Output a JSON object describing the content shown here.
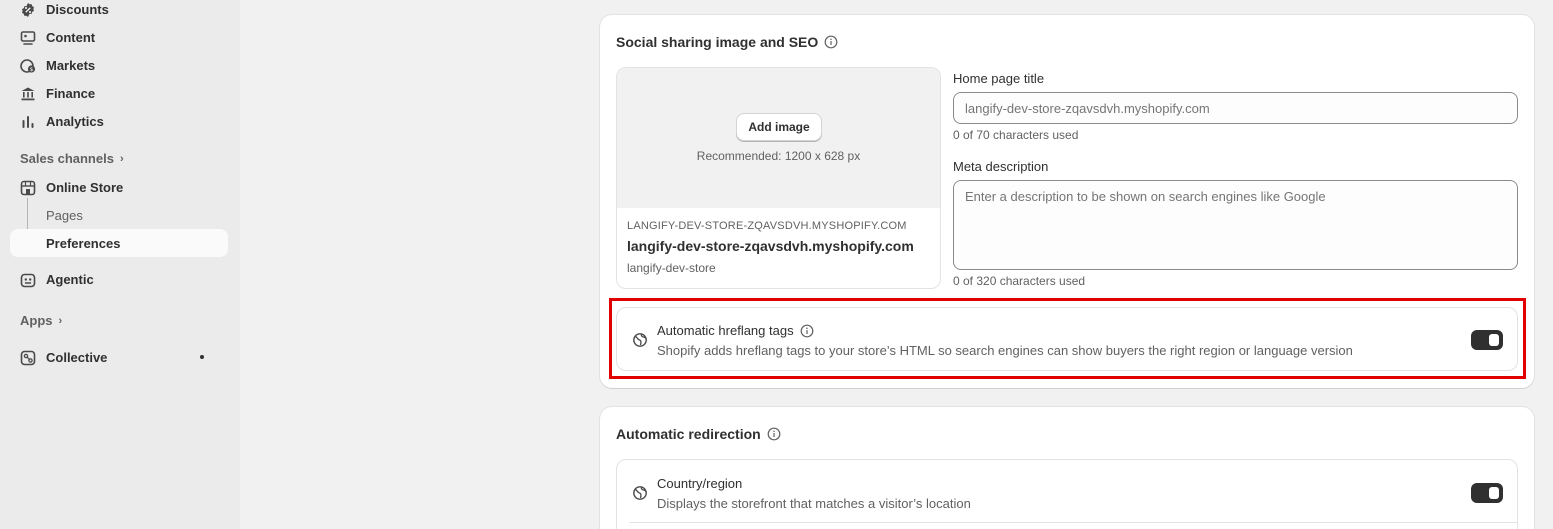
{
  "sidebar": {
    "items": [
      {
        "label": "Discounts",
        "icon": "discount-icon"
      },
      {
        "label": "Content",
        "icon": "content-icon"
      },
      {
        "label": "Markets",
        "icon": "globe-dollar-icon"
      },
      {
        "label": "Finance",
        "icon": "bank-icon"
      },
      {
        "label": "Analytics",
        "icon": "bar-chart-icon"
      }
    ],
    "sales_channels_label": "Sales channels",
    "online_store": {
      "label": "Online Store",
      "icon": "store-icon"
    },
    "pages_label": "Pages",
    "preferences_label": "Preferences",
    "agentic": {
      "label": "Agentic",
      "icon": "robot-icon"
    },
    "apps_label": "Apps",
    "collective": {
      "label": "Collective",
      "icon": "collective-icon"
    }
  },
  "seo_card": {
    "title": "Social sharing image and SEO",
    "add_image_label": "Add image",
    "recommended_text": "Recommended: 1200 x 628 px",
    "preview": {
      "domain": "LANGIFY-DEV-STORE-ZQAVSDVH.MYSHOPIFY.COM",
      "title": "langify-dev-store-zqavsdvh.myshopify.com",
      "subtitle": "langify-dev-store"
    },
    "home_title_label": "Home page title",
    "home_title_placeholder": "langify-dev-store-zqavsdvh.myshopify.com",
    "home_title_help": "0 of 70 characters used",
    "meta_label": "Meta description",
    "meta_placeholder": "Enter a description to be shown on search engines like Google",
    "meta_help": "0 of 320 characters used",
    "hreflang": {
      "title": "Automatic hreflang tags",
      "description": "Shopify adds hreflang tags to your store’s HTML so search engines can show buyers the right region or language version",
      "enabled": true
    }
  },
  "redirect_card": {
    "title": "Automatic redirection",
    "country": {
      "title": "Country/region",
      "description": "Displays the storefront that matches a visitor’s location",
      "enabled": true
    }
  },
  "colors": {
    "highlight": "#e00000",
    "toggle_on": "#303030"
  }
}
